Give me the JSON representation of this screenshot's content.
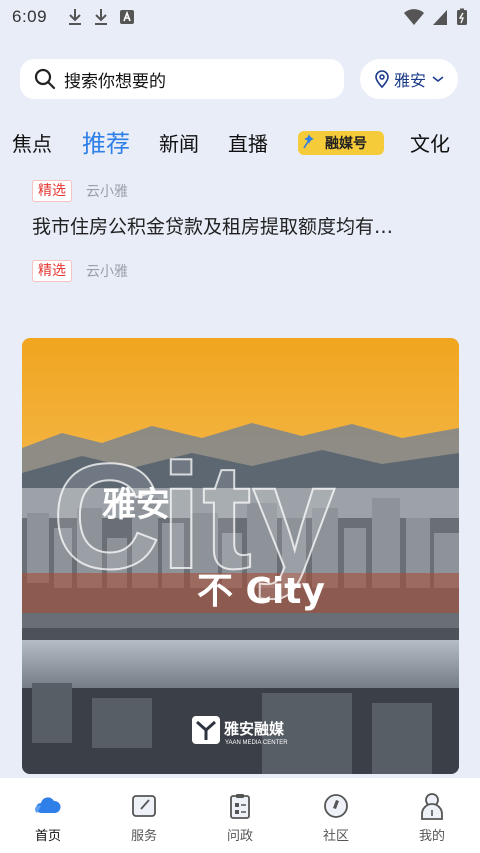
{
  "status_bar": {
    "time": "6:09"
  },
  "search": {
    "placeholder": "搜索你想要的",
    "location": "雅安"
  },
  "tabs": [
    {
      "label": "焦点"
    },
    {
      "label": "推荐",
      "active": true
    },
    {
      "label": "新闻"
    },
    {
      "label": "直播"
    },
    {
      "label": "融媒号",
      "badge": true
    },
    {
      "label": "文化"
    }
  ],
  "feed": {
    "items": [
      {
        "tag": "精选",
        "source": "云小雅",
        "headline": "我市住房公积金贷款及租房提取额度均有…"
      },
      {
        "tag": "精选",
        "source": "云小雅"
      }
    ],
    "card": {
      "title_big": "City",
      "city_name": "雅安",
      "slogan": "不 City",
      "brand": "雅安融媒",
      "brand_sub": "YAAN MEDIA CENTER"
    }
  },
  "bottom_nav": [
    {
      "label": "首页",
      "icon": "home-cloud-icon",
      "active": true
    },
    {
      "label": "服务",
      "icon": "service-icon"
    },
    {
      "label": "问政",
      "icon": "clipboard-icon"
    },
    {
      "label": "社区",
      "icon": "compass-icon"
    },
    {
      "label": "我的",
      "icon": "profile-icon"
    }
  ],
  "colors": {
    "accent": "#2f7fe8",
    "tag_red": "#e53935",
    "badge_yellow": "#f6cb3a",
    "background": "#e9edf8"
  }
}
